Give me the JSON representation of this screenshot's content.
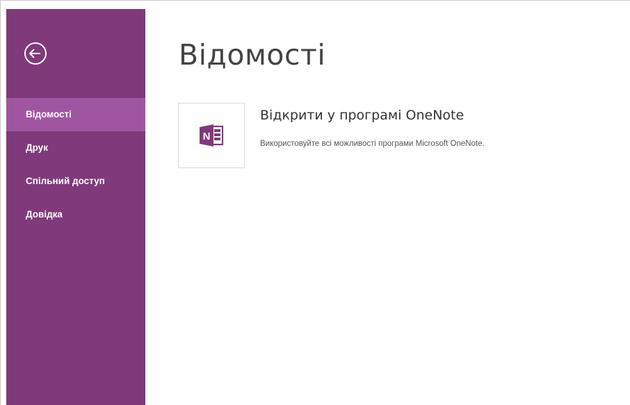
{
  "colors": {
    "sidebar_bg": "#80397b",
    "sidebar_active": "#a055a0",
    "onenote_brand": "#80397b",
    "title_text": "#444444"
  },
  "sidebar": {
    "back_icon": "arrow-left-circle-icon",
    "items": [
      {
        "label": "Відомості",
        "active": true
      },
      {
        "label": "Друк",
        "active": false
      },
      {
        "label": "Спільний доступ",
        "active": false
      },
      {
        "label": "Довідка",
        "active": false
      }
    ]
  },
  "main": {
    "title": "Відомості",
    "action": {
      "icon": "onenote-logo-icon",
      "icon_letter": "N",
      "title": "Відкрити у програмі OneNote",
      "description": "Використовуйте всі можливості програми Microsoft OneNote."
    }
  }
}
